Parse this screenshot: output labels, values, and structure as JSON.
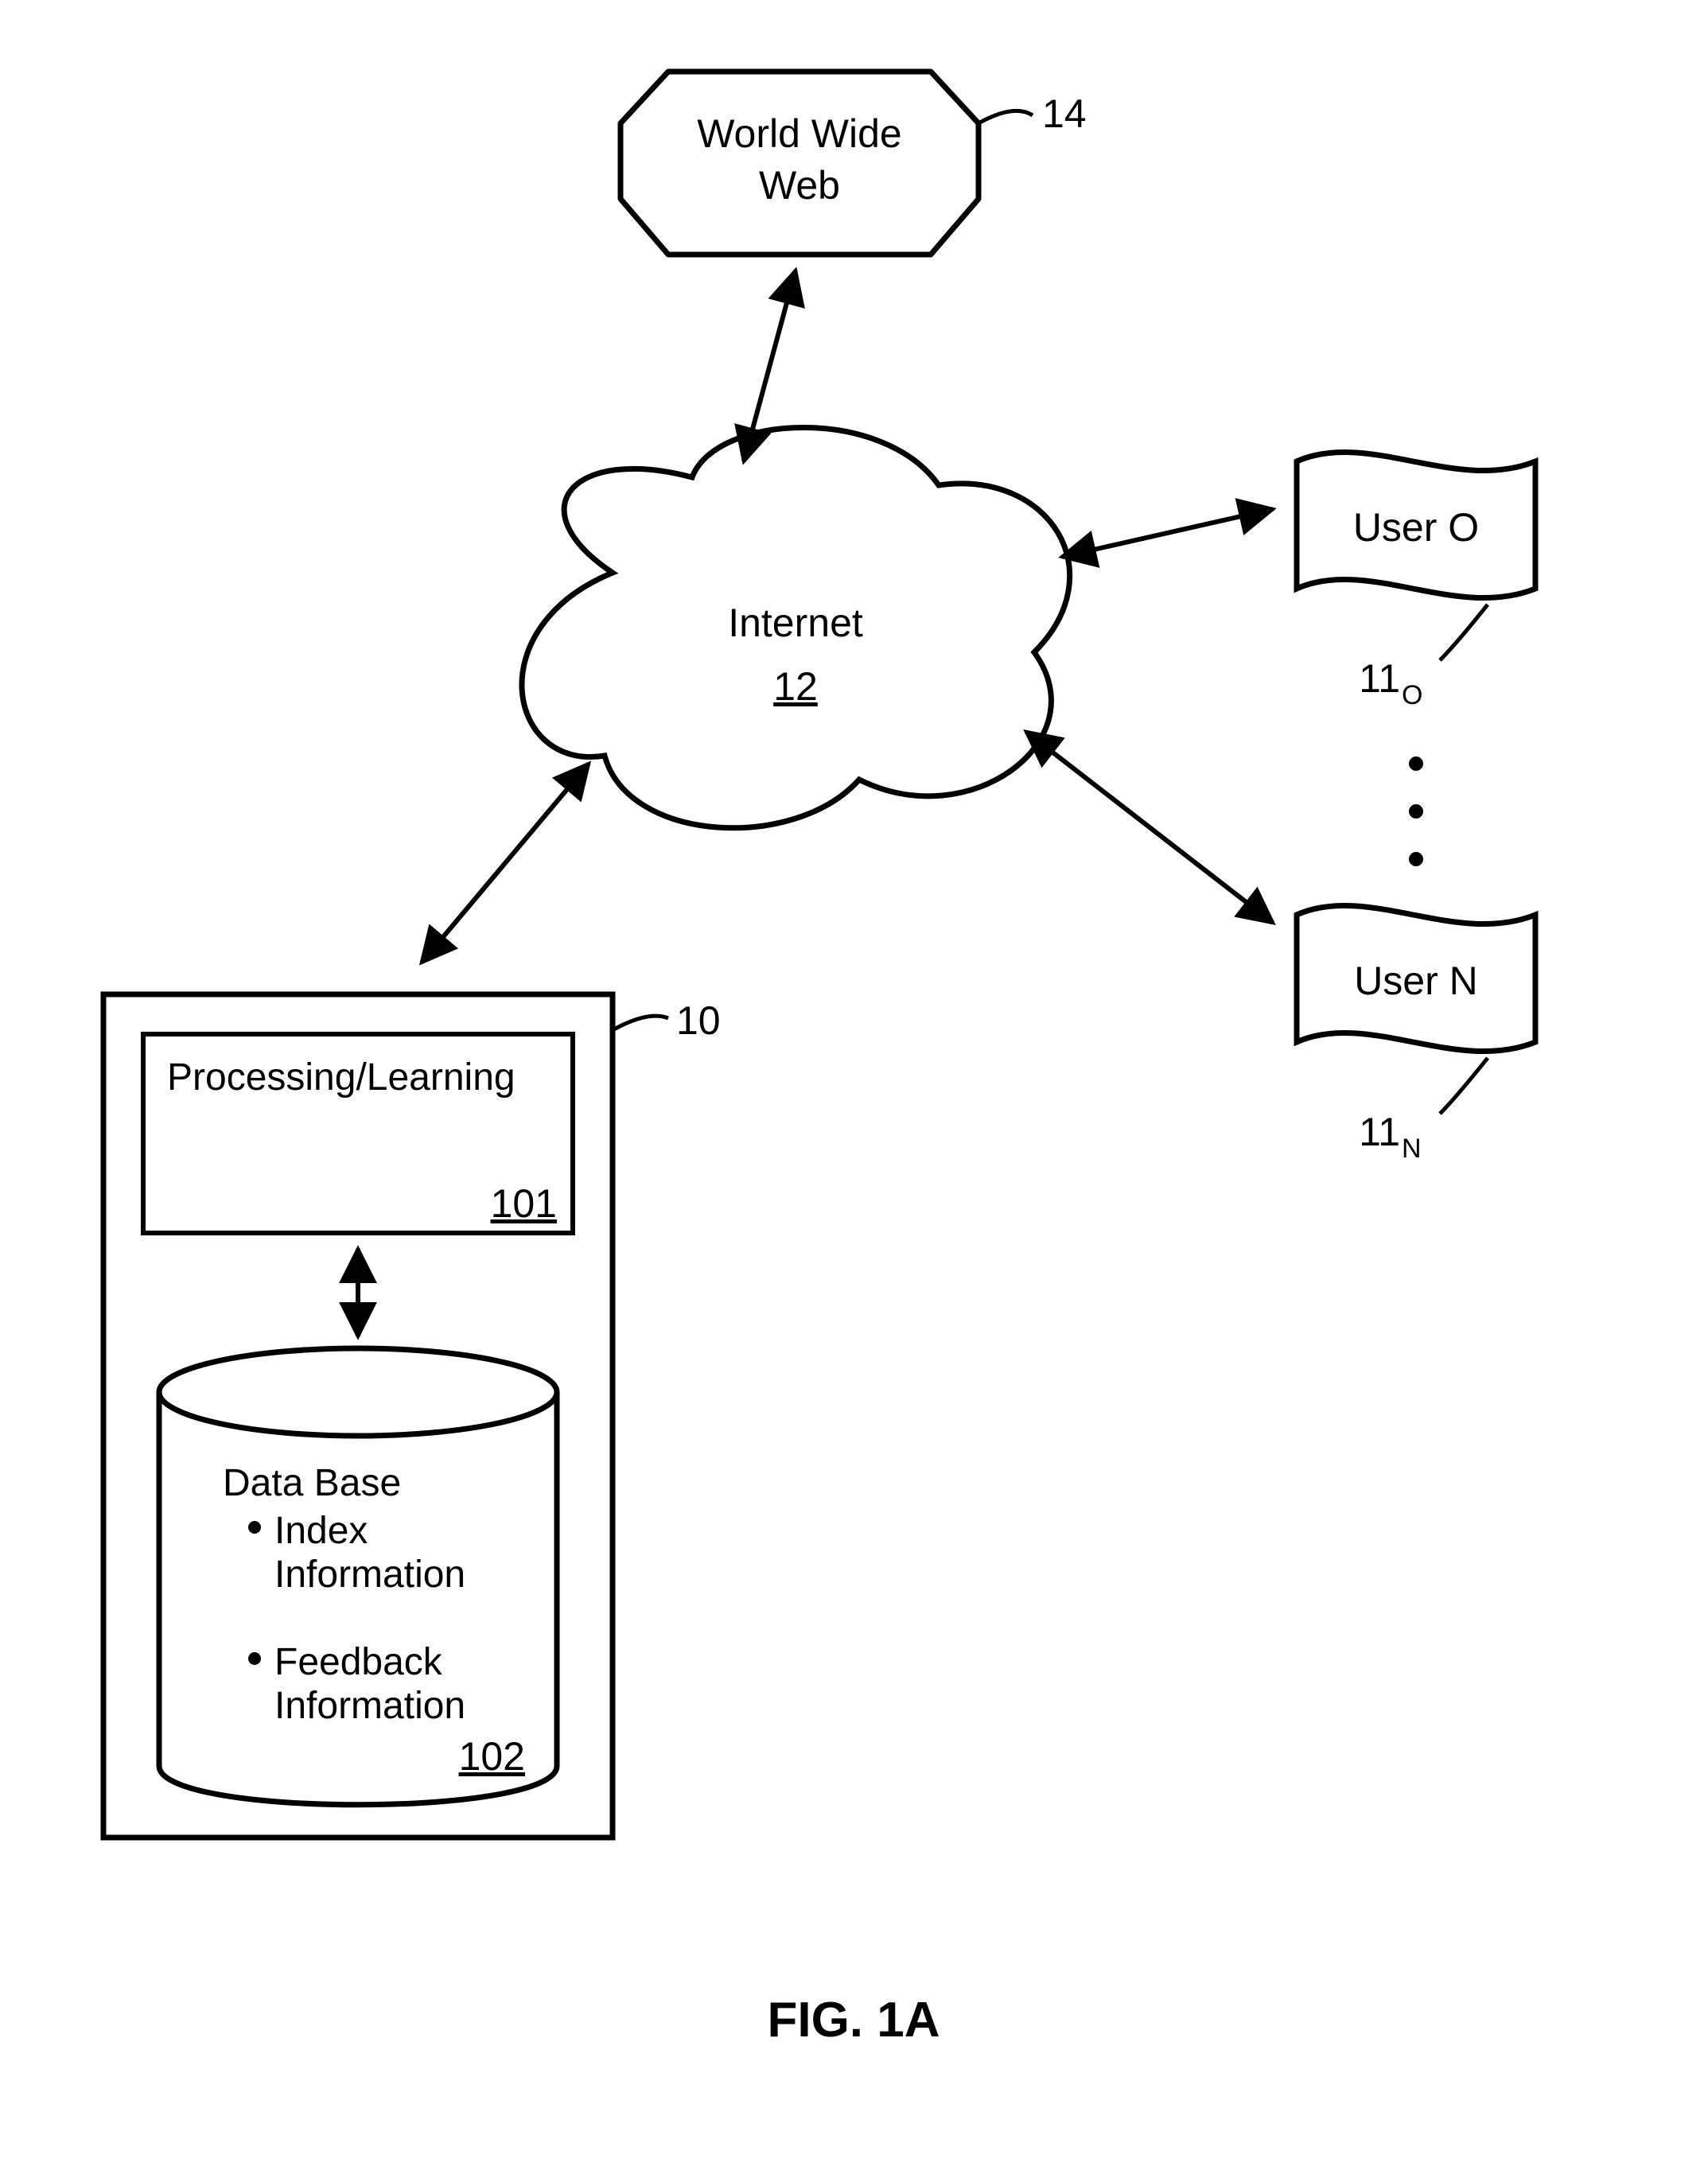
{
  "www": {
    "line1": "World Wide",
    "line2": "Web",
    "ref": "14"
  },
  "internet": {
    "label": "Internet",
    "ref": "12"
  },
  "users": {
    "first": {
      "label": "User O",
      "ref": "11",
      "refsub": "O"
    },
    "last": {
      "label": "User N",
      "ref": "11",
      "refsub": "N"
    }
  },
  "system": {
    "ref": "10",
    "proc": {
      "label": "Processing/Learning",
      "ref": "101"
    },
    "db": {
      "title": "Data Base",
      "b1a": "Index",
      "b1b": "Information",
      "b2a": "Feedback",
      "b2b": "Information",
      "ref": "102"
    }
  },
  "figure": "FIG. 1A"
}
